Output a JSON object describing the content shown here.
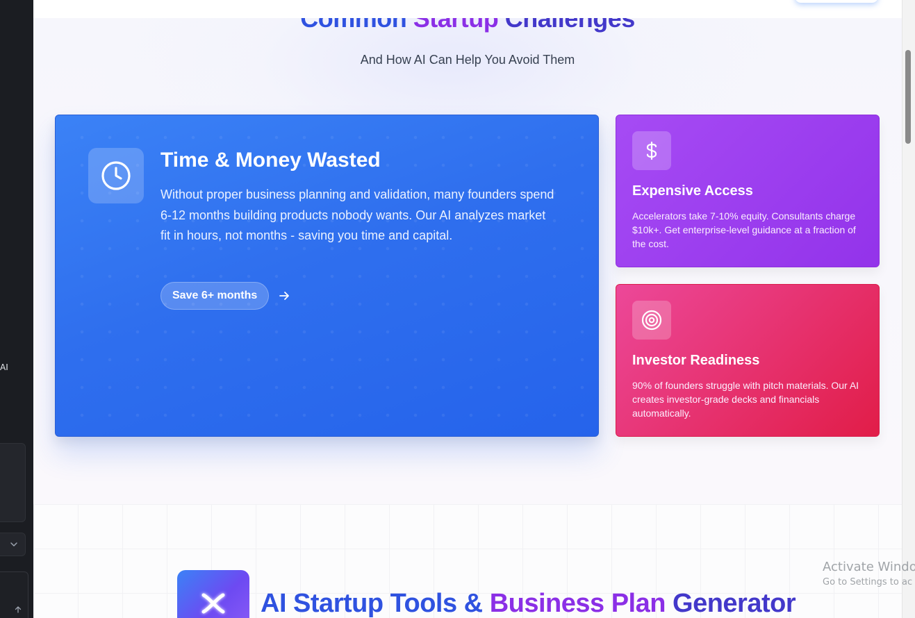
{
  "sidebar": {
    "partial_text": "AI"
  },
  "challenges": {
    "title_part1": "Common ",
    "title_part2": "Startup",
    "title_part3": " Challenges",
    "subtitle": "And How AI Can Help You Avoid Them"
  },
  "cards": {
    "main": {
      "icon": "clock-icon",
      "title": "Time & Money Wasted",
      "description": "Without proper business planning and validation, many founders spend 6-12 months building products nobody wants. Our AI analyzes market fit in hours, not months - saving you time and capital.",
      "badge": "Save 6+ months",
      "color": "#3b82f6"
    },
    "expensive": {
      "icon": "dollar-icon",
      "title": "Expensive Access",
      "description": "Accelerators take 7-10% equity. Consultants charge $10k+. Get enterprise-level guidance at a fraction of the cost.",
      "color": "#9333ea"
    },
    "investor": {
      "icon": "target-icon",
      "title": "Investor Readiness",
      "description": "90% of founders struggle with pitch materials. Our AI creates investor-grade decks and financials automatically.",
      "color": "#e11d48"
    }
  },
  "tools": {
    "title_part1": "AI Startup Tools & ",
    "title_part2": "Business Plan",
    "title_part3": " Generator"
  },
  "watermark": {
    "line1": "Activate Windo",
    "line2": "Go to Settings to ac"
  }
}
